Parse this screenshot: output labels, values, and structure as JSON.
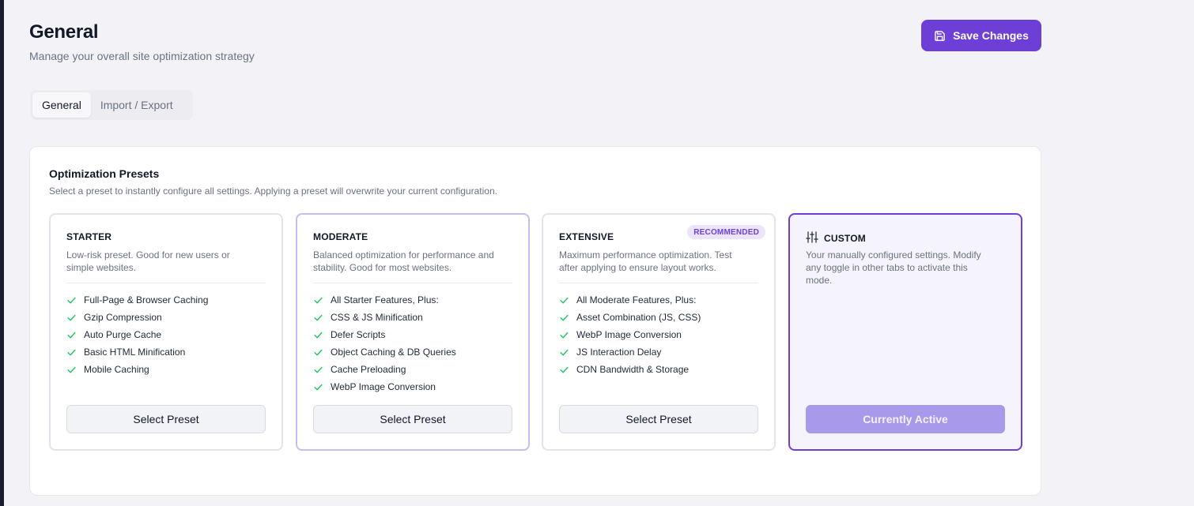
{
  "header": {
    "title": "General",
    "subtitle": "Manage your overall site optimization strategy",
    "save_label": "Save Changes"
  },
  "tabs": [
    {
      "label": "General",
      "active": true
    },
    {
      "label": "Import / Export",
      "active": false
    }
  ],
  "presets": {
    "title": "Optimization Presets",
    "description": "Select a preset to instantly configure all settings. Applying a preset will overwrite your current configuration.",
    "cards": [
      {
        "name": "STARTER",
        "description": "Low-risk preset. Good for new users or simple websites.",
        "features": [
          "Full-Page & Browser Caching",
          "Gzip Compression",
          "Auto Purge Cache",
          "Basic HTML Minification",
          "Mobile Caching"
        ],
        "button": "Select Preset"
      },
      {
        "name": "MODERATE",
        "description": "Balanced optimization for performance and stability. Good for most websites.",
        "features": [
          "All Starter Features, Plus:",
          "CSS & JS Minification",
          "Defer Scripts",
          "Object Caching & DB Queries",
          "Cache Preloading",
          "WebP Image Conversion"
        ],
        "button": "Select Preset"
      },
      {
        "name": "EXTENSIVE",
        "badge": "RECOMMENDED",
        "description": "Maximum performance optimization. Test after applying to ensure layout works.",
        "features": [
          "All Moderate Features, Plus:",
          "Asset Combination (JS, CSS)",
          "WebP Image Conversion",
          "JS Interaction Delay",
          "CDN Bandwidth & Storage"
        ],
        "button": "Select Preset"
      },
      {
        "name": "CUSTOM",
        "icon": "sliders-icon",
        "description": "Your manually configured settings. Modify any toggle in other tabs to activate this mode.",
        "button": "Currently Active",
        "active": true
      }
    ]
  },
  "colors": {
    "accent": "#6d3fd6",
    "accent_muted": "#a899ea",
    "check": "#22c55e",
    "background": "#f3f3f7"
  }
}
